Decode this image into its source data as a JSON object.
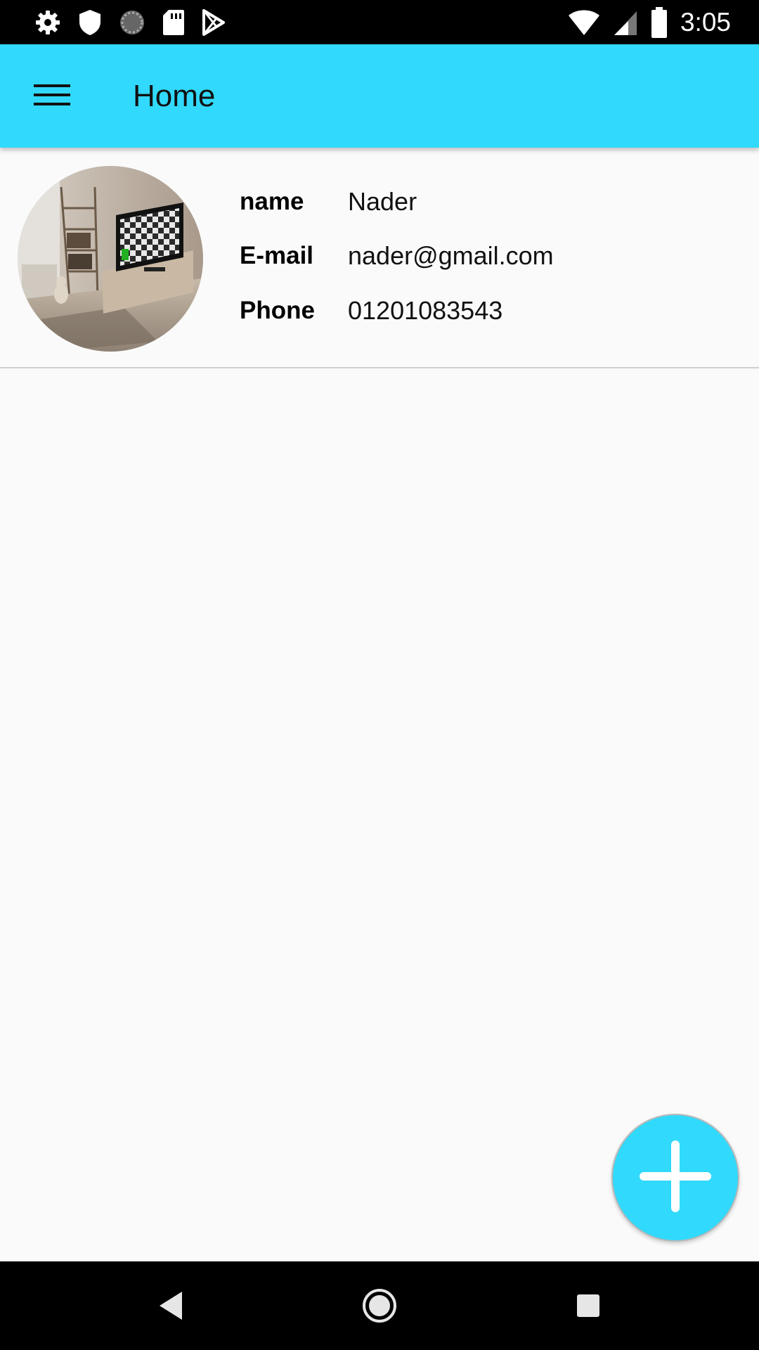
{
  "status_bar": {
    "time": "3:05",
    "left_icons": [
      "gear-icon",
      "shield-icon",
      "sync-circle-icon",
      "sd-card-icon",
      "play-store-icon"
    ],
    "right_icons": [
      "wifi-icon",
      "signal-icon",
      "battery-icon"
    ]
  },
  "app_bar": {
    "title": "Home",
    "menu_icon": "hamburger-menu-icon",
    "color": "#31d9fc"
  },
  "profile": {
    "avatar_icon": "room-photo-avatar",
    "rows": [
      {
        "label": "name",
        "value": "Nader"
      },
      {
        "label": "E-mail",
        "value": "nader@gmail.com"
      },
      {
        "label": "Phone",
        "value": "01201083543"
      }
    ]
  },
  "fab": {
    "icon": "plus-icon",
    "color": "#31d9fc"
  },
  "nav_bar": {
    "icons": [
      "back-triangle-icon",
      "home-circle-icon",
      "recents-square-icon"
    ]
  }
}
